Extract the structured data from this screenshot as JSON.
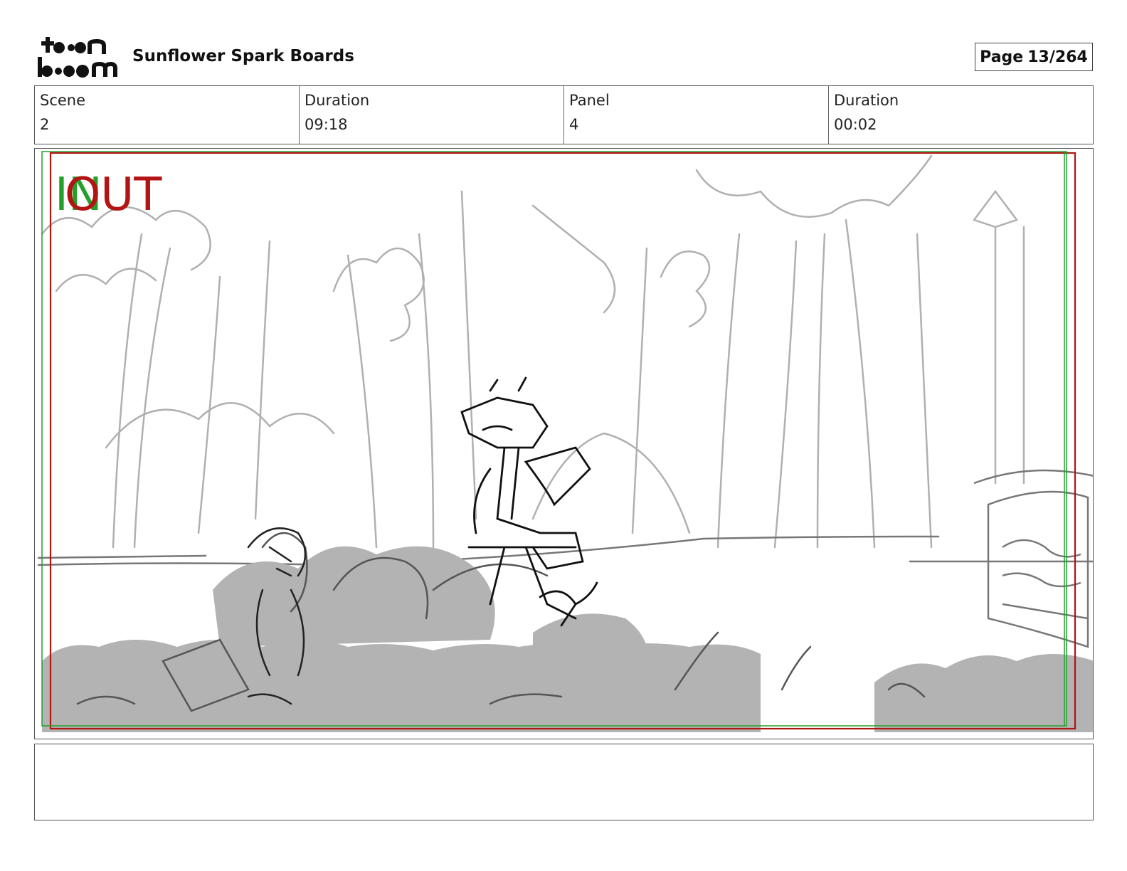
{
  "header": {
    "logo_text_top": "toon",
    "logo_text_bottom": "boom",
    "project_title": "Sunflower Spark Boards",
    "page_label": "Page",
    "page_value": "13/264"
  },
  "info": [
    {
      "label": "Scene",
      "value": "2"
    },
    {
      "label": "Duration",
      "value": "09:18"
    },
    {
      "label": "Panel",
      "value": "4"
    },
    {
      "label": "Duration",
      "value": "00:02"
    }
  ],
  "panel": {
    "in_label": "IN",
    "out_label": "OUT",
    "in_color": "#22a02a",
    "out_color": "#b21414",
    "safe_frame_color": "#b21414"
  },
  "notes": {
    "text": ""
  }
}
